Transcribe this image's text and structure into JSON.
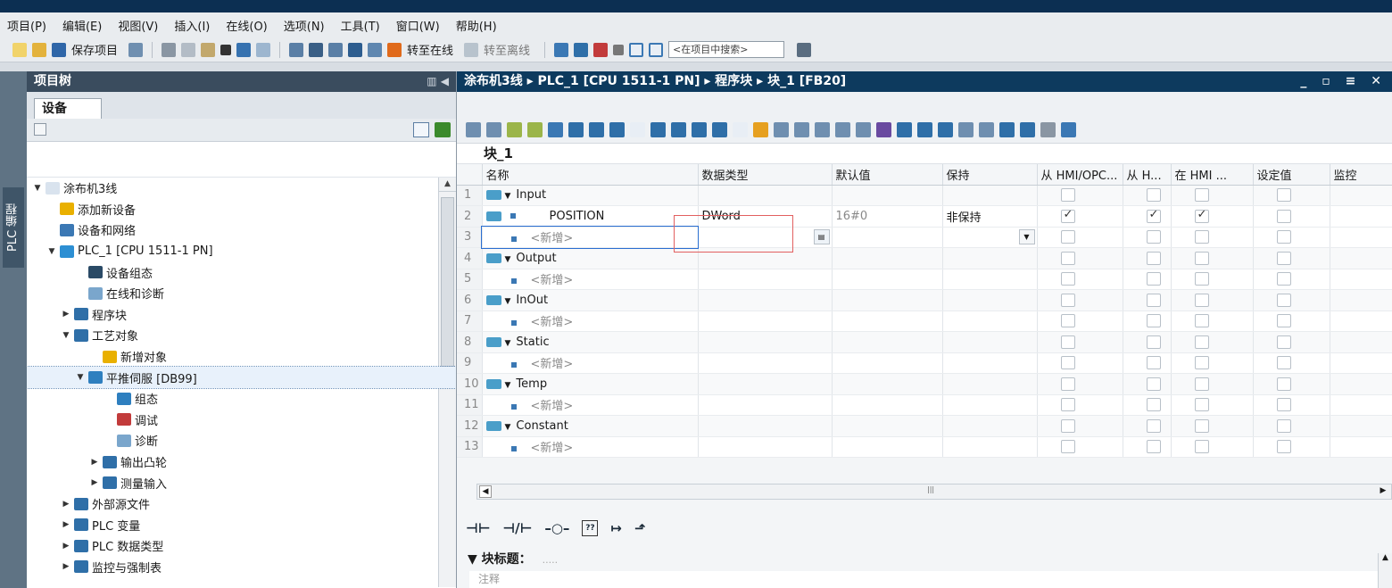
{
  "menubar": {
    "items": [
      "项目(P)",
      "编辑(E)",
      "视图(V)",
      "插入(I)",
      "在线(O)",
      "选项(N)",
      "工具(T)",
      "窗口(W)",
      "帮助(H)"
    ]
  },
  "toolbar": {
    "save_label": "保存项目",
    "go_online_label": "转至在线",
    "go_offline_label": "转至离线",
    "search_placeholder": "<在项目中搜索>"
  },
  "left_strip": {
    "label": "PLC 编程"
  },
  "project_tree": {
    "title": "项目树",
    "tab": "设备",
    "items": [
      {
        "label": "涂布机3线",
        "indent": 0,
        "arrow": "▼",
        "icon_color": "#d9e3ee"
      },
      {
        "label": "添加新设备",
        "indent": 1,
        "arrow": "",
        "icon_color": "#e9b000"
      },
      {
        "label": "设备和网络",
        "indent": 1,
        "arrow": "",
        "icon_color": "#3b78b4"
      },
      {
        "label": "PLC_1 [CPU 1511-1 PN]",
        "indent": 1,
        "arrow": "▼",
        "icon_color": "#2d8fd3"
      },
      {
        "label": "设备组态",
        "indent": 3,
        "arrow": "",
        "icon_color": "#2a4a66"
      },
      {
        "label": "在线和诊断",
        "indent": 3,
        "arrow": "",
        "icon_color": "#7aa6cc"
      },
      {
        "label": "程序块",
        "indent": 2,
        "arrow": "▶",
        "icon_color": "#2f6fa8"
      },
      {
        "label": "工艺对象",
        "indent": 2,
        "arrow": "▼",
        "icon_color": "#2f6fa8"
      },
      {
        "label": "新增对象",
        "indent": 4,
        "arrow": "",
        "icon_color": "#e9b000"
      },
      {
        "label": "平推伺服 [DB99]",
        "indent": 3,
        "arrow": "▼",
        "icon_color": "#2e7fbf",
        "selected": true
      },
      {
        "label": "组态",
        "indent": 5,
        "arrow": "",
        "icon_color": "#2e7fbf"
      },
      {
        "label": "调试",
        "indent": 5,
        "arrow": "",
        "icon_color": "#c23b3b"
      },
      {
        "label": "诊断",
        "indent": 5,
        "arrow": "",
        "icon_color": "#7aa6cc"
      },
      {
        "label": "输出凸轮",
        "indent": 4,
        "arrow": "▶",
        "icon_color": "#2f6fa8"
      },
      {
        "label": "测量输入",
        "indent": 4,
        "arrow": "▶",
        "icon_color": "#2f6fa8"
      },
      {
        "label": "外部源文件",
        "indent": 2,
        "arrow": "▶",
        "icon_color": "#2f6fa8"
      },
      {
        "label": "PLC 变量",
        "indent": 2,
        "arrow": "▶",
        "icon_color": "#2f6fa8"
      },
      {
        "label": "PLC 数据类型",
        "indent": 2,
        "arrow": "▶",
        "icon_color": "#2f6fa8"
      },
      {
        "label": "监控与强制表",
        "indent": 2,
        "arrow": "▶",
        "icon_color": "#2f6fa8"
      }
    ]
  },
  "editor": {
    "breadcrumb": "涂布机3线 ▸ PLC_1 [CPU 1511-1 PN] ▸ 程序块 ▸ 块_1 [FB20]",
    "block_name": "块_1",
    "columns": [
      "",
      "名称",
      "数据类型",
      "默认值",
      "保持",
      "从 HMI/OPC...",
      "从 H...",
      "在 HMI ...",
      "设定值",
      "监控"
    ],
    "rows": [
      {
        "num": "1",
        "kind": "section",
        "name": "Input",
        "type": "",
        "default": "",
        "retain": "",
        "c1": false,
        "c2": false,
        "c3": false,
        "c4": false
      },
      {
        "num": "2",
        "kind": "var",
        "name": "POSITION",
        "type": "DWord",
        "default": "16#0",
        "retain": "非保持",
        "c1": true,
        "c2": true,
        "c3": true,
        "c4": false
      },
      {
        "num": "3",
        "kind": "new",
        "name": "<新增>",
        "type": "",
        "default": "",
        "retain": "",
        "c1": false,
        "c2": false,
        "c3": false,
        "c4": false
      },
      {
        "num": "4",
        "kind": "section",
        "name": "Output",
        "type": "",
        "default": "",
        "retain": "",
        "c1": false,
        "c2": false,
        "c3": false,
        "c4": false
      },
      {
        "num": "5",
        "kind": "new",
        "name": "<新增>",
        "type": "",
        "default": "",
        "retain": "",
        "c1": false,
        "c2": false,
        "c3": false,
        "c4": false
      },
      {
        "num": "6",
        "kind": "section",
        "name": "InOut",
        "type": "",
        "default": "",
        "retain": "",
        "c1": false,
        "c2": false,
        "c3": false,
        "c4": false
      },
      {
        "num": "7",
        "kind": "new",
        "name": "<新增>",
        "type": "",
        "default": "",
        "retain": "",
        "c1": false,
        "c2": false,
        "c3": false,
        "c4": false
      },
      {
        "num": "8",
        "kind": "section",
        "name": "Static",
        "type": "",
        "default": "",
        "retain": "",
        "c1": false,
        "c2": false,
        "c3": false,
        "c4": false
      },
      {
        "num": "9",
        "kind": "new",
        "name": "<新增>",
        "type": "",
        "default": "",
        "retain": "",
        "c1": false,
        "c2": false,
        "c3": false,
        "c4": false
      },
      {
        "num": "10",
        "kind": "section",
        "name": "Temp",
        "type": "",
        "default": "",
        "retain": "",
        "c1": false,
        "c2": false,
        "c3": false,
        "c4": false
      },
      {
        "num": "11",
        "kind": "new",
        "name": "<新增>",
        "type": "",
        "default": "",
        "retain": "",
        "c1": false,
        "c2": false,
        "c3": false,
        "c4": false
      },
      {
        "num": "12",
        "kind": "section",
        "name": "Constant",
        "type": "",
        "default": "",
        "retain": "",
        "c1": false,
        "c2": false,
        "c3": false,
        "c4": false
      },
      {
        "num": "13",
        "kind": "new",
        "name": "<新增>",
        "type": "",
        "default": "",
        "retain": "",
        "c1": false,
        "c2": false,
        "c3": false,
        "c4": false
      }
    ],
    "block_heading": "块标题：",
    "block_heading_dots": ".....",
    "comment": "注释"
  },
  "colors": {
    "accent": "#0d3a5e",
    "selection": "#2a6ed1",
    "highlight_box": "#e26060"
  }
}
